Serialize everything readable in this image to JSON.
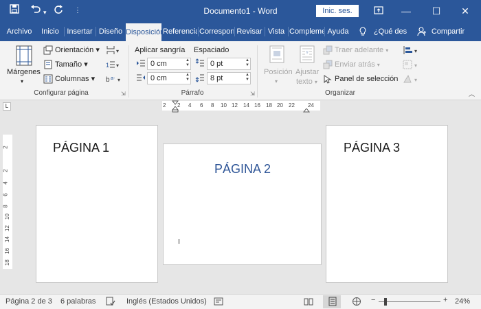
{
  "titlebar": {
    "title": "Documento1  -  Word",
    "signin_label": "Inic. ses."
  },
  "tabs": {
    "items": [
      {
        "label": "Archivo"
      },
      {
        "label": "Inicio"
      },
      {
        "label": "Insertar"
      },
      {
        "label": "Diseño"
      },
      {
        "label": "Disposición"
      },
      {
        "label": "Referencias"
      },
      {
        "label": "Correspondencia"
      },
      {
        "label": "Revisar"
      },
      {
        "label": "Vista"
      },
      {
        "label": "Complementos"
      },
      {
        "label": "Ayuda"
      }
    ],
    "tell_me": "¿Qué des",
    "share": "Compartir"
  },
  "ribbon": {
    "margins": "Márgenes",
    "orientation": "Orientación",
    "size": "Tamaño",
    "columns": "Columnas",
    "group_page_setup": "Configurar página",
    "indent_header": "Aplicar sangría",
    "spacing_header": "Espaciado",
    "indent_left": "0 cm",
    "indent_right": "0 cm",
    "spacing_before": "0 pt",
    "spacing_after": "8 pt",
    "group_paragraph": "Párrafo",
    "position": "Posición",
    "wrap_1": "Ajustar",
    "wrap_2": "texto",
    "bring_forward": "Traer adelante",
    "send_backward": "Enviar atrás",
    "selection_pane": "Panel de selección",
    "group_arrange": "Organizar"
  },
  "ruler": {
    "corner": "L",
    "h_ticks": [
      "2",
      "2",
      "4",
      "6",
      "8",
      "10",
      "12",
      "14",
      "16",
      "18",
      "20",
      "22",
      "24"
    ],
    "v_ticks": [
      "2",
      "2",
      "4",
      "6",
      "8",
      "10",
      "12",
      "14",
      "16",
      "18"
    ]
  },
  "pages": {
    "p1": "PÁGINA 1",
    "p2": "PÁGINA 2",
    "p3": "PÁGINA 3"
  },
  "status": {
    "page": "Página 2 de 3",
    "words": "6 palabras",
    "language": "Inglés (Estados Unidos)",
    "zoom": "24%"
  },
  "colors": {
    "accent": "#2b579a",
    "page2_heading": "#2e5597"
  }
}
